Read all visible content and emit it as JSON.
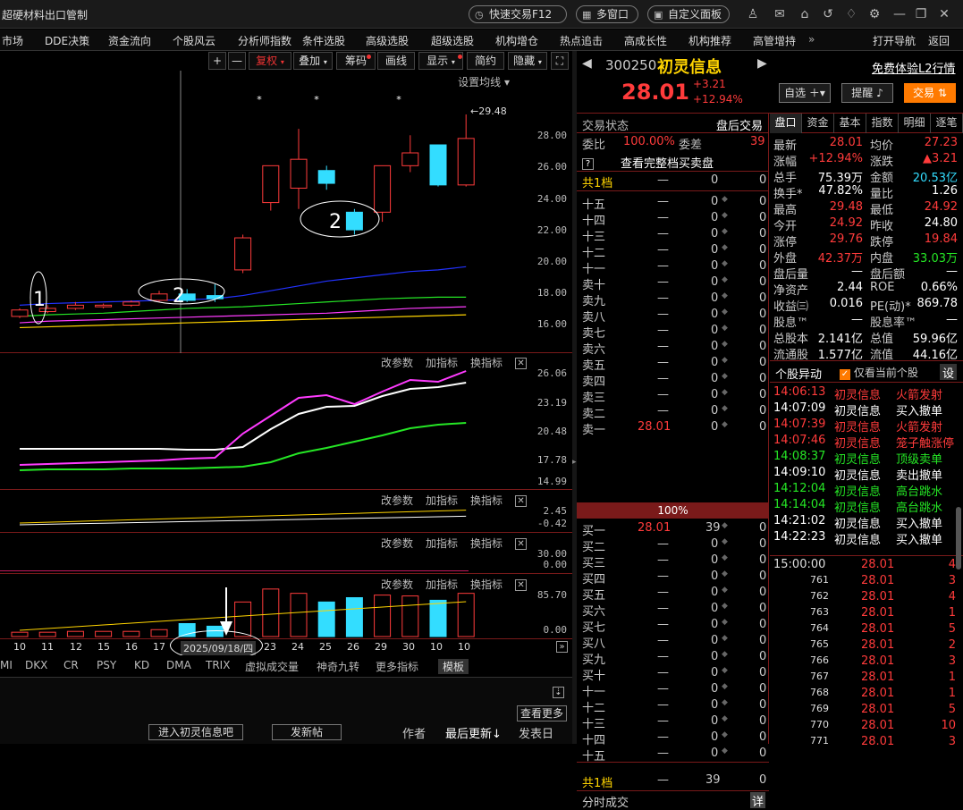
{
  "window": {
    "title": "超硬材料出口管制",
    "quick_trade": "快速交易F12",
    "multi_window": "多窗口",
    "custom_panel": "自定义面板"
  },
  "menu": [
    "市场",
    "DDE决策",
    "资金流向",
    "个股风云",
    "分析师指数",
    "条件选股",
    "高级选股",
    "超级选股",
    "机构增仓",
    "热点追击",
    "高成长性",
    "机构推荐",
    "高管增持",
    "打开导航",
    "返回"
  ],
  "chart_toolbar": {
    "plus": "+",
    "minus": "—",
    "fuquan": "复权",
    "overlay": "叠加",
    "chips": "筹码",
    "drawline": "画线",
    "display": "显示",
    "simple": "简约",
    "hide": "隐藏"
  },
  "main_chart": {
    "ma_setting": "设置均线",
    "high_marker": "29.48",
    "y_ticks": [
      "28.00",
      "26.00",
      "24.00",
      "22.00",
      "20.00",
      "18.00",
      "16.00"
    ],
    "annotation_1": "1",
    "annotation_2a": "2",
    "annotation_2b": "2"
  },
  "panes": [
    {
      "ctrl": [
        "改参数",
        "加指标",
        "换指标"
      ],
      "ticks": [
        "26.06",
        "23.19",
        "20.48",
        "17.78",
        "14.99"
      ]
    },
    {
      "ctrl": [
        "改参数",
        "加指标",
        "换指标"
      ],
      "ticks": [
        "2.45",
        "-0.42"
      ]
    },
    {
      "ctrl": [
        "改参数",
        "加指标",
        "换指标"
      ],
      "ticks": [
        "30.00",
        "0.00"
      ]
    },
    {
      "ctrl": [
        "改参数",
        "加指标",
        "换指标"
      ],
      "ticks": [
        "85.70",
        "0.00"
      ]
    }
  ],
  "date_axis": [
    "10",
    "11",
    "12",
    "15",
    "16",
    "17",
    "2025/09/18/四",
    "23",
    "24",
    "25",
    "26",
    "29",
    "30",
    "10",
    "10"
  ],
  "indicator_tabs": [
    "MI",
    "DKX",
    "CR",
    "PSY",
    "KD",
    "DMA",
    "TRIX",
    "虚拟成交量",
    "神奇九转",
    "更多指标",
    "模板"
  ],
  "lower_panel": {
    "check_more": "查看更多",
    "enter_forum": "进入初灵信息吧",
    "new_post": "发新帖",
    "author": "作者",
    "last_update": "最后更新",
    "post_date": "发表日"
  },
  "stock": {
    "code": "300250",
    "name": "初灵信息",
    "price": "28.01",
    "change": "+3.21",
    "change_pct": "+12.94%",
    "l2": "免费体验L2行情",
    "watchlist": "自选",
    "alert": "提醒",
    "trade": "交易"
  },
  "orderbook": {
    "status_label": "交易状态",
    "status_value": "盘后交易",
    "weibi_label": "委比",
    "weibi_value": "100.00%",
    "weicha_label": "委差",
    "weicha_value": "39",
    "full_book": "查看完整档买卖盘",
    "total_label": "共1档",
    "mid_pct": "100%",
    "sell_levels": [
      "十五",
      "十四",
      "十三",
      "十二",
      "十一",
      "卖十",
      "卖九",
      "卖八",
      "卖七",
      "卖六",
      "卖五",
      "卖四",
      "卖三",
      "卖二",
      "卖一"
    ],
    "buy_levels": [
      "买一",
      "买二",
      "买三",
      "买四",
      "买五",
      "买六",
      "买七",
      "买八",
      "买九",
      "买十",
      "十一",
      "十二",
      "十三",
      "十四",
      "十五"
    ],
    "dash": "—",
    "zero": "0",
    "sell1_price": "28.01",
    "buy1_price": "28.01",
    "buy1_vol": "39",
    "bottom_label": "共1档",
    "bottom_vol": "39",
    "bottom_zero": "0",
    "ticks_label": "分时成交",
    "ticks_detail": "详"
  },
  "quote": {
    "tabs": [
      "盘口",
      "资金",
      "基本",
      "指数",
      "明细",
      "逐笔"
    ],
    "rows": [
      [
        "最新",
        "28.01",
        "均价",
        "27.23"
      ],
      [
        "涨幅",
        "+12.94%",
        "涨跌",
        "▲3.21"
      ],
      [
        "总手",
        "75.39万",
        "金额",
        "20.53亿"
      ],
      [
        "换手*",
        "47.82%",
        "量比",
        "1.26"
      ],
      [
        "最高",
        "29.48",
        "最低",
        "24.92"
      ],
      [
        "今开",
        "24.92",
        "昨收",
        "24.80"
      ],
      [
        "涨停",
        "29.76",
        "跌停",
        "19.84"
      ],
      [
        "外盘",
        "42.37万",
        "内盘",
        "33.03万"
      ],
      [
        "盘后量",
        "—",
        "盘后额",
        "—"
      ],
      [
        "净资产",
        "2.44",
        "ROE",
        "0.66%"
      ],
      [
        "收益㈢",
        "0.016",
        "PE(动)*",
        "869.78"
      ],
      [
        "股息™",
        "—",
        "股息率™",
        "—"
      ],
      [
        "总股本",
        "2.141亿",
        "总值",
        "59.96亿"
      ],
      [
        "流通股",
        "1.577亿",
        "流值",
        "44.16亿"
      ]
    ],
    "events_title": "个股异动",
    "events_filter": "仅看当前个股",
    "events_setting": "设",
    "events": [
      [
        "14:06:13",
        "初灵信息",
        "火箭发射",
        "red"
      ],
      [
        "14:07:09",
        "初灵信息",
        "买入撤单",
        "white"
      ],
      [
        "14:07:39",
        "初灵信息",
        "火箭发射",
        "red"
      ],
      [
        "14:07:46",
        "初灵信息",
        "笼子触涨停",
        "red"
      ],
      [
        "14:08:37",
        "初灵信息",
        "顶级卖单",
        "green"
      ],
      [
        "14:09:10",
        "初灵信息",
        "卖出撤单",
        "white"
      ],
      [
        "14:12:04",
        "初灵信息",
        "高台跳水",
        "green"
      ],
      [
        "14:14:04",
        "初灵信息",
        "高台跳水",
        "green"
      ],
      [
        "14:21:02",
        "初灵信息",
        "买入撤单",
        "white"
      ],
      [
        "14:22:23",
        "初灵信息",
        "买入撤单",
        "white"
      ]
    ],
    "trades": [
      [
        "15:00:00",
        "28.01",
        "4"
      ],
      [
        "761",
        "28.01",
        "3"
      ],
      [
        "762",
        "28.01",
        "4"
      ],
      [
        "763",
        "28.01",
        "1"
      ],
      [
        "764",
        "28.01",
        "5"
      ],
      [
        "765",
        "28.01",
        "2"
      ],
      [
        "766",
        "28.01",
        "3"
      ],
      [
        "767",
        "28.01",
        "1"
      ],
      [
        "768",
        "28.01",
        "1"
      ],
      [
        "769",
        "28.01",
        "5"
      ],
      [
        "770",
        "28.01",
        "10"
      ],
      [
        "771",
        "28.01",
        "3"
      ]
    ]
  },
  "chart_data": {
    "type": "candlestick",
    "candles": [
      {
        "o": 16.9,
        "c": 17.3,
        "h": 17.4,
        "l": 16.8,
        "up": true
      },
      {
        "o": 17.2,
        "c": 17.4,
        "h": 17.6,
        "l": 17.1,
        "up": true
      },
      {
        "o": 17.4,
        "c": 17.6,
        "h": 17.8,
        "l": 17.3,
        "up": true
      },
      {
        "o": 17.5,
        "c": 17.6,
        "h": 17.7,
        "l": 17.4,
        "up": true
      },
      {
        "o": 17.6,
        "c": 17.8,
        "h": 17.9,
        "l": 17.5,
        "up": true
      },
      {
        "o": 17.9,
        "c": 18.3,
        "h": 18.5,
        "l": 17.8,
        "up": true
      },
      {
        "o": 18.3,
        "c": 17.9,
        "h": 18.6,
        "l": 17.8,
        "up": false
      },
      {
        "o": 18.2,
        "c": 18.0,
        "h": 18.9,
        "l": 17.8,
        "up": false
      },
      {
        "o": 19.8,
        "c": 21.8,
        "h": 22.0,
        "l": 19.6,
        "up": true
      },
      {
        "o": 24.0,
        "c": 26.3,
        "h": 26.3,
        "l": 23.5,
        "up": true
      },
      {
        "o": 24.9,
        "c": 26.7,
        "h": 28.6,
        "l": 23.6,
        "up": true
      },
      {
        "o": 25.2,
        "c": 26.0,
        "h": 26.3,
        "l": 24.8,
        "up": false
      },
      {
        "o": 23.4,
        "c": 22.3,
        "h": 23.6,
        "l": 22.0,
        "up": false
      },
      {
        "o": 23.4,
        "c": 26.3,
        "h": 26.3,
        "l": 22.8,
        "up": true
      },
      {
        "o": 26.3,
        "c": 27.1,
        "h": 28.2,
        "l": 25.9,
        "up": true
      },
      {
        "o": 27.6,
        "c": 25.1,
        "h": 27.6,
        "l": 25.0,
        "up": false
      },
      {
        "o": 25.1,
        "c": 28.0,
        "h": 29.5,
        "l": 25.0,
        "up": true
      }
    ],
    "ma_lines": {
      "blue": [
        17.6,
        17.7,
        17.75,
        17.8,
        17.85,
        17.9,
        17.95,
        18.0,
        18.2,
        18.5,
        18.8,
        19.1,
        19.3,
        19.5,
        19.7,
        19.8,
        20.0
      ],
      "green": [
        16.9,
        17.0,
        17.05,
        17.1,
        17.2,
        17.3,
        17.4,
        17.45,
        17.5,
        17.6,
        17.7,
        17.8,
        17.9,
        18.0,
        18.05,
        18.1,
        18.1
      ],
      "magenta": [
        16.5,
        16.6,
        16.65,
        16.7,
        16.75,
        16.8,
        16.85,
        16.9,
        16.95,
        17.0,
        17.05,
        17.1,
        17.2,
        17.3,
        17.4,
        17.45,
        17.5
      ],
      "yellow": [
        16.2,
        16.25,
        16.3,
        16.35,
        16.4,
        16.45,
        16.5,
        16.55,
        16.6,
        16.65,
        16.7,
        16.75,
        16.8,
        16.85,
        16.9,
        16.95,
        17.0
      ]
    },
    "ylim": [
      15.5,
      30.0
    ],
    "volume": [
      5,
      5,
      6,
      6,
      6,
      8,
      15,
      12,
      40,
      55,
      50,
      40,
      45,
      48,
      47,
      42,
      50
    ]
  }
}
